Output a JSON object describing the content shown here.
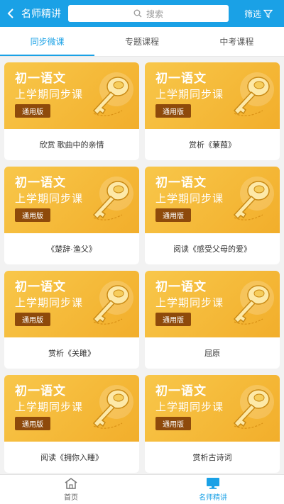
{
  "header": {
    "title": "名师精讲",
    "search_placeholder": "搜索",
    "filter_label": "筛选"
  },
  "tabs": [
    {
      "label": "同步微课",
      "active": true
    },
    {
      "label": "专题课程",
      "active": false
    },
    {
      "label": "中考课程",
      "active": false
    }
  ],
  "thumbnail": {
    "line1": "初一语文",
    "line2": "上学期同步课",
    "badge": "通用版"
  },
  "cards": [
    {
      "title": "欣赏 歌曲中的亲情"
    },
    {
      "title": "赏析《蒹葭》"
    },
    {
      "title": "《楚辞·渔父》"
    },
    {
      "title": "阅读《感受父母的爱》"
    },
    {
      "title": "赏析《关雎》"
    },
    {
      "title": "屈原"
    },
    {
      "title": "阅读《拥你入睡》"
    },
    {
      "title": "赏析古诗词"
    }
  ],
  "bottom_nav": [
    {
      "label": "首页",
      "icon": "home-icon",
      "active": false
    },
    {
      "label": "名师精讲",
      "icon": "monitor-icon",
      "active": true
    }
  ],
  "colors": {
    "accent": "#1aa1e6",
    "thumb_bg": "#f2ae2b",
    "badge_bg": "#8e4a0b"
  }
}
